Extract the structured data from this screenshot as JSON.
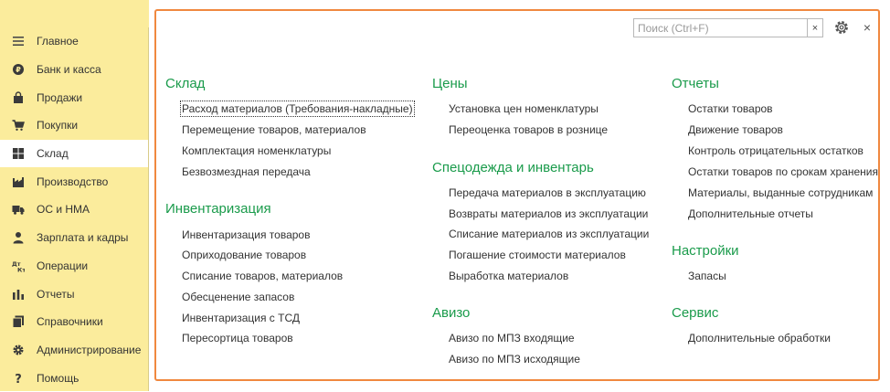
{
  "sidebar": {
    "items": [
      {
        "label": "Главное",
        "icon": "menu-lines-icon"
      },
      {
        "label": "Банк и касса",
        "icon": "coin-icon"
      },
      {
        "label": "Продажи",
        "icon": "shopping-bag-icon"
      },
      {
        "label": "Покупки",
        "icon": "cart-icon"
      },
      {
        "label": "Склад",
        "icon": "warehouse-grid-icon"
      },
      {
        "label": "Производство",
        "icon": "factory-icon"
      },
      {
        "label": "ОС и НМА",
        "icon": "truck-icon"
      },
      {
        "label": "Зарплата и кадры",
        "icon": "person-icon"
      },
      {
        "label": "Операции",
        "icon": "debit-credit-icon"
      },
      {
        "label": "Отчеты",
        "icon": "bar-chart-icon"
      },
      {
        "label": "Справочники",
        "icon": "books-icon"
      },
      {
        "label": "Администрирование",
        "icon": "gear-icon"
      },
      {
        "label": "Помощь",
        "icon": "question-icon"
      }
    ],
    "active_index": 4
  },
  "header": {
    "search_placeholder": "Поиск (Ctrl+F)",
    "search_value": "",
    "clear_label": "×",
    "close_label": "×"
  },
  "sections": {
    "sklad": {
      "title": "Склад",
      "links": [
        "Расход материалов (Требования-накладные)",
        "Перемещение товаров, материалов",
        "Комплектация номенклатуры",
        "Безвозмездная передача"
      ]
    },
    "inventory": {
      "title": "Инвентаризация",
      "links": [
        "Инвентаризация товаров",
        "Оприходование товаров",
        "Списание товаров, материалов",
        "Обесценение запасов",
        "Инвентаризация с ТСД",
        "Пересортица товаров"
      ]
    },
    "prices": {
      "title": "Цены",
      "links": [
        "Установка цен номенклатуры",
        "Переоценка товаров в рознице"
      ]
    },
    "workwear": {
      "title": "Спецодежда и инвентарь",
      "links": [
        "Передача материалов в эксплуатацию",
        "Возвраты материалов из эксплуатации",
        "Списание материалов из эксплуатации",
        "Погашение стоимости материалов",
        "Выработка материалов"
      ]
    },
    "aviso": {
      "title": "Авизо",
      "links": [
        "Авизо по МПЗ входящие",
        "Авизо по МПЗ исходящие"
      ]
    },
    "reports": {
      "title": "Отчеты",
      "links": [
        "Остатки товаров",
        "Движение товаров",
        "Контроль отрицательных остатков",
        "Остатки товаров по срокам хранения",
        "Материалы, выданные сотрудникам",
        "Дополнительные отчеты"
      ]
    },
    "settings": {
      "title": "Настройки",
      "links": [
        "Запасы"
      ]
    },
    "service": {
      "title": "Сервис",
      "links": [
        "Дополнительные обработки"
      ]
    }
  },
  "colors": {
    "sidebar_bg": "#fbec9c",
    "section_title": "#1a9b4b",
    "panel_border": "#f0883f"
  }
}
